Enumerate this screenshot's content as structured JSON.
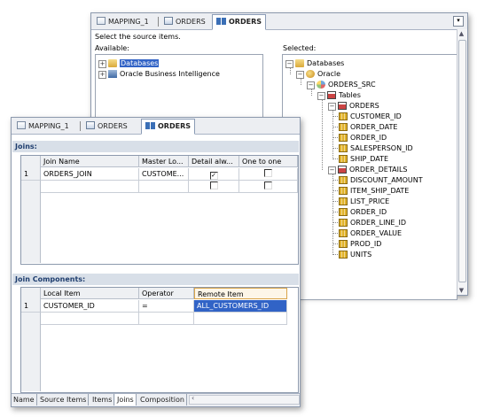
{
  "back_window": {
    "tabs": [
      {
        "label": "MAPPING_1",
        "icon": "mapping-icon"
      },
      {
        "label": "ORDERS",
        "icon": "datastore-icon"
      },
      {
        "label": "ORDERS",
        "icon": "dataset-icon",
        "active": true
      }
    ],
    "instruction": "Select the source items.",
    "available_label": "Available:",
    "selected_label": "Selected:",
    "available_tree": [
      {
        "label": "Databases",
        "selected": true,
        "icon": "folder-icon"
      },
      {
        "label": "Oracle Business Intelligence",
        "icon": "obi-icon"
      }
    ],
    "selected_tree": {
      "root": "Databases",
      "oracle": "Oracle",
      "src": "ORDERS_SRC",
      "tables": "Tables",
      "orders": "ORDERS",
      "orders_columns": [
        "CUSTOMER_ID",
        "ORDER_DATE",
        "ORDER_ID",
        "SALESPERSON_ID",
        "SHIP_DATE"
      ],
      "order_details": "ORDER_DETAILS",
      "order_details_columns": [
        "DISCOUNT_AMOUNT",
        "ITEM_SHIP_DATE",
        "LIST_PRICE",
        "ORDER_ID",
        "ORDER_LINE_ID",
        "ORDER_VALUE",
        "PROD_ID",
        "UNITS"
      ]
    }
  },
  "front_window": {
    "tabs": [
      {
        "label": "MAPPING_1",
        "icon": "mapping-icon"
      },
      {
        "label": "ORDERS",
        "icon": "datastore-icon"
      },
      {
        "label": "ORDERS",
        "icon": "dataset-icon",
        "active": true
      }
    ],
    "joins": {
      "title": "Joins:",
      "columns": [
        "Join Name",
        "Master Lo...",
        "Detail alw...",
        "One to one"
      ],
      "rows": [
        {
          "num": "1",
          "name": "ORDERS_JOIN",
          "master": "CUSTOME...",
          "detail_checked": true,
          "one_to_one": false
        },
        {
          "num": "",
          "name": "",
          "master": "",
          "detail_checked": false,
          "one_to_one": false
        }
      ]
    },
    "join_components": {
      "title": "Join Components:",
      "columns": [
        "Local Item",
        "Operator",
        "Remote Item"
      ],
      "rows": [
        {
          "num": "1",
          "local": "CUSTOMER_ID",
          "operator": "=",
          "remote": "ALL_CUSTOMERS_ID"
        }
      ]
    },
    "bottom_tabs": [
      "Name",
      "Source Items",
      "Items",
      "Joins",
      "Composition"
    ],
    "active_bottom_tab": "Joins"
  },
  "colors": {
    "selection": "#3163c6",
    "section_title_bg": "#d8dfe8",
    "section_title_text": "#1e3d6e"
  }
}
